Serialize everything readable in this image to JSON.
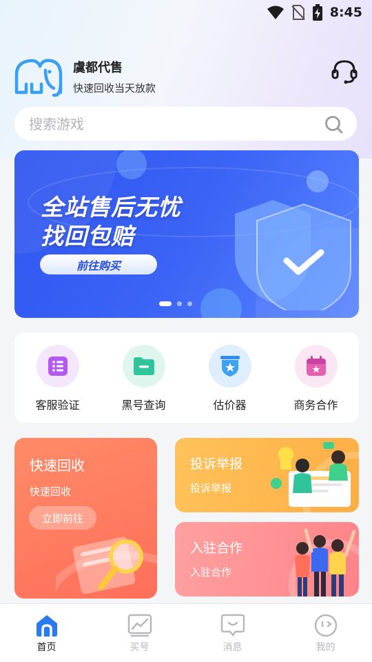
{
  "status_bar": {
    "time": "8:45"
  },
  "header": {
    "brand_name": "虞都代售",
    "slogan": "快速回收当天放款"
  },
  "search": {
    "placeholder": "搜索游戏",
    "value": ""
  },
  "banner": {
    "line1": "全站售后无忧",
    "line2": "找回包赔",
    "button_label": "前往购买",
    "slide_count": 3,
    "active_slide": 1
  },
  "quick_actions": [
    {
      "label": "客服验证",
      "icon": "list-icon"
    },
    {
      "label": "黑号查询",
      "icon": "folder-icon"
    },
    {
      "label": "估价器",
      "icon": "shield-icon"
    },
    {
      "label": "商务合作",
      "icon": "calendar-star-icon"
    }
  ],
  "cards": {
    "recycle": {
      "title": "快速回收",
      "subtitle": "快速回收",
      "button_label": "立即前往"
    },
    "complaint": {
      "title": "投诉举报",
      "subtitle": "投诉举报"
    },
    "partner": {
      "title": "入驻合作",
      "subtitle": "入驻合作"
    }
  },
  "tabs": [
    {
      "label": "首页",
      "icon": "home-icon",
      "active": true
    },
    {
      "label": "买号",
      "icon": "chart-icon",
      "active": false
    },
    {
      "label": "消息",
      "icon": "message-icon",
      "active": false
    },
    {
      "label": "我的",
      "icon": "profile-face-icon",
      "active": false
    }
  ],
  "colors": {
    "accent_blue": "#2f56f0",
    "recycle_card": "#ff7f5e",
    "complaint_card": "#ffb64a",
    "partner_card": "#ff8a8f",
    "tab_active_icon": "#2a7bf0"
  }
}
